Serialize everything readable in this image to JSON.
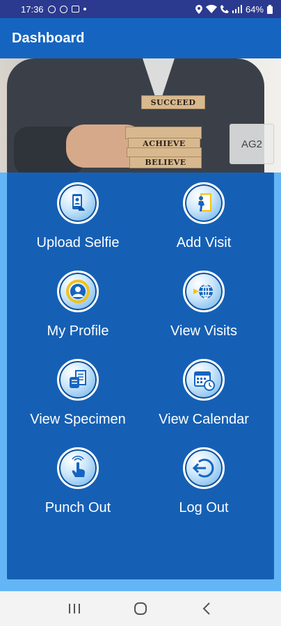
{
  "status_bar": {
    "time": "17:36",
    "battery": "64%"
  },
  "app_bar": {
    "title": "Dashboard"
  },
  "hero": {
    "blocks": [
      "SUCCEED",
      "ACHIEVE",
      "BELIEVE"
    ],
    "badge": "AG2"
  },
  "tiles": [
    {
      "label": "Upload Selfie",
      "icon": "upload-selfie-icon"
    },
    {
      "label": "Add Visit",
      "icon": "add-visit-icon"
    },
    {
      "label": "My Profile",
      "icon": "profile-icon"
    },
    {
      "label": "View Visits",
      "icon": "view-visits-icon"
    },
    {
      "label": "View Specimen",
      "icon": "specimen-icon"
    },
    {
      "label": "View Calendar",
      "icon": "calendar-icon"
    },
    {
      "label": "Punch Out",
      "icon": "punch-out-icon"
    },
    {
      "label": "Log Out",
      "icon": "logout-icon"
    }
  ],
  "nav_bar": {
    "buttons": [
      "recent-apps",
      "home",
      "back"
    ]
  },
  "colors": {
    "status_bar": "#2b3a8f",
    "app_bar": "#1565c0",
    "panel": "#1560b5",
    "below_panel": "#64b5f6"
  }
}
